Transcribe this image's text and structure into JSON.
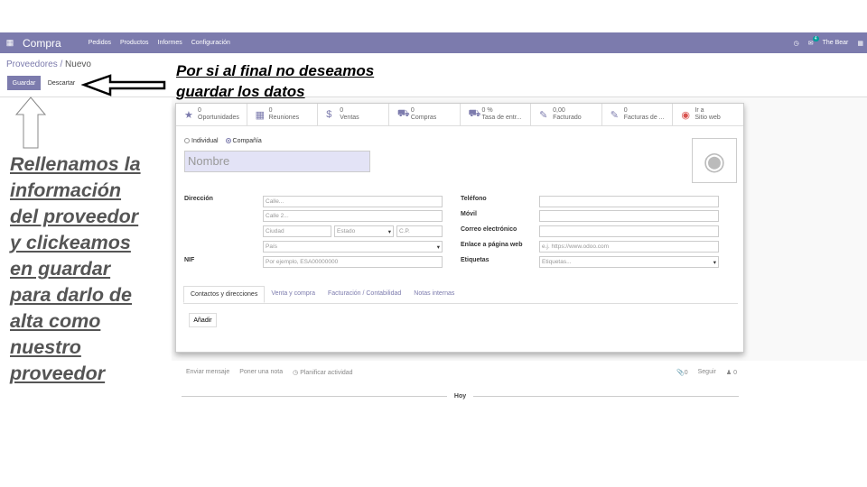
{
  "navbar": {
    "app_name": "Compra",
    "menu": [
      "Pedidos",
      "Productos",
      "Informes",
      "Configuración"
    ],
    "chat_count": "4",
    "user": "The Bear"
  },
  "breadcrumb": {
    "parent": "Proveedores",
    "separator": " / ",
    "current": "Nuevo"
  },
  "buttons": {
    "save": "Guardar",
    "discard": "Descartar"
  },
  "stats": [
    {
      "icon": "star-icon",
      "value": "0",
      "label": "Oportunidades"
    },
    {
      "icon": "calendar-icon",
      "value": "0",
      "label": "Reuniones"
    },
    {
      "icon": "dollar-icon",
      "value": "0",
      "label": "Ventas"
    },
    {
      "icon": "cart-icon",
      "value": "0",
      "label": "Compras"
    },
    {
      "icon": "truck-icon",
      "value": "0 %",
      "label": "Tasa de entr..."
    },
    {
      "icon": "pencil-square-icon",
      "value": "0,00",
      "label": "Facturado"
    },
    {
      "icon": "pencil-square-icon",
      "value": "0",
      "label": "Facturas de ..."
    },
    {
      "icon": "globe-icon",
      "value": "Ir a",
      "label": "Sitio web"
    }
  ],
  "company_type": {
    "individual": "Individual",
    "company": "Compañía",
    "selected": "company"
  },
  "name_placeholder": "Nombre",
  "labels": {
    "address": "Dirección",
    "nif": "NIF",
    "phone": "Teléfono",
    "mobile": "Móvil",
    "email": "Correo electrónico",
    "website": "Enlace a página web",
    "tags": "Etiquetas"
  },
  "placeholders": {
    "street": "Calle...",
    "street2": "Calle 2...",
    "city": "Ciudad",
    "state": "Estado",
    "zip": "C.P.",
    "country": "País",
    "nif": "Por ejemplo, ESA00000000",
    "website": "e.j. https://www.odoo.com",
    "tags": "Etiquetas..."
  },
  "tabs": [
    "Contactos y direcciones",
    "Venta y compra",
    "Facturación / Contabilidad",
    "Notas internas"
  ],
  "add_button": "Añadir",
  "chatter": {
    "send_message": "Enviar mensaje",
    "log_note": "Poner una nota",
    "schedule": "Planificar actividad",
    "attachments": "0",
    "follow": "Seguir",
    "followers": "0",
    "today": "Hoy"
  },
  "annotations": {
    "top": [
      "Por si al final no deseamos",
      "guardar los datos"
    ],
    "left": [
      "Rellenamos la",
      "información",
      "del proveedor",
      "y clickeamos",
      "en guardar",
      "para darlo de",
      "alta como",
      "nuestro",
      "proveedor"
    ]
  }
}
